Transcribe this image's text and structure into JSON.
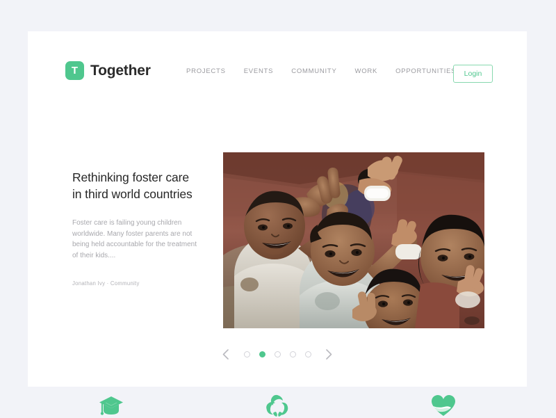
{
  "theme": {
    "page_background": "#f2f3f8",
    "card_background": "#ffffff",
    "accent_green": "#4fc78e",
    "nav_text": "#9a9a9f",
    "heading_text": "#272727",
    "body_text": "#a8a8ad"
  },
  "header": {
    "logo_letter": "T",
    "brand_name": "Together",
    "nav_items": [
      {
        "label": "PROJECTS"
      },
      {
        "label": "EVENTS"
      },
      {
        "label": "COMMUNITY"
      },
      {
        "label": "WORK"
      },
      {
        "label": "OPPORTUNITIES"
      }
    ],
    "login_label": "Login"
  },
  "hero": {
    "title": "Rethinking foster care in third world countries",
    "excerpt": "Foster care is failing young children worldwide. Many foster parents are not being held accountable for the treatment of their kids....",
    "author": "Jonathan Ivy",
    "meta_separator": "·",
    "category": "Community",
    "image_alt": "Group of smiling children looking up at the camera making peace signs"
  },
  "carousel": {
    "prev_icon": "chevron-left-icon",
    "next_icon": "chevron-right-icon",
    "total_slides": 5,
    "active_slide": 2,
    "dots": [
      {
        "active": false
      },
      {
        "active": true
      },
      {
        "active": false
      },
      {
        "active": false
      },
      {
        "active": false
      }
    ]
  },
  "features": [
    {
      "icon": "graduation-cap-icon"
    },
    {
      "icon": "recycle-leaves-icon"
    },
    {
      "icon": "heart-hand-icon"
    }
  ]
}
